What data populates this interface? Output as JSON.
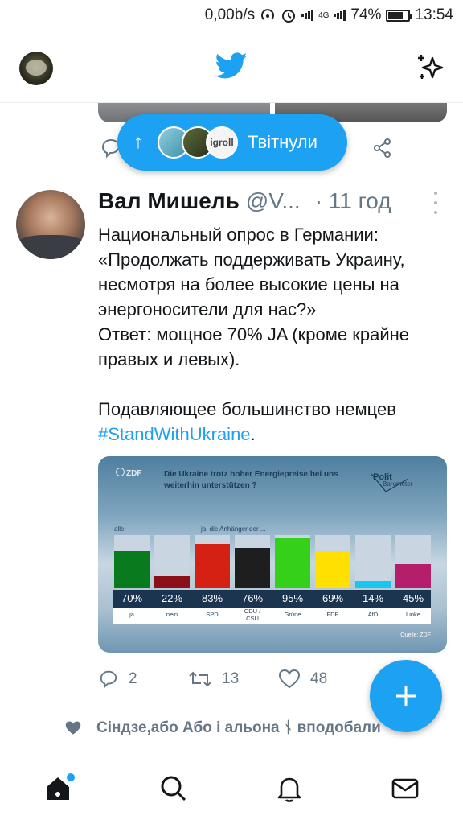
{
  "status_bar": {
    "speed": "0,00b/s",
    "network": "4G",
    "battery": "74%",
    "battery_level": 0.74,
    "time": "13:54"
  },
  "header": {
    "logo_icon": "twitter-bird-icon",
    "right_icon": "sparkle-icon",
    "brand_color": "#1da1f2"
  },
  "new_tweets_pill": {
    "label": "Твітнули",
    "avatar3_text": "igroll"
  },
  "tweet": {
    "name": "Вал Мишель",
    "handle": "@V...",
    "time": "· 11 год",
    "lines": [
      "Национальный опрос в Германии:",
      "«Продолжать поддерживать Украину, несмотря на более высокие цены на энергоносители для нас?»",
      "Ответ: мощное 70% JA (кроме крайне правых и левых)."
    ],
    "line2": "Подавляющее большинство немцев",
    "hashtag": "#StandWithUkraine",
    "trailing": ".",
    "actions": {
      "replies": "2",
      "retweets": "13",
      "likes": "48"
    },
    "liked_by": "Сіндзе,або Або і альона ᚾ вподобали"
  },
  "chart_data": {
    "type": "bar",
    "title": "Die Ukraine trotz hoher Energiepreise bei uns weiterhin unterstützen ?",
    "brand_left": "ZDF",
    "brand_right_top": "Polit",
    "brand_right_bottom": "Barometer",
    "group1_label": "alle",
    "group2_label": "ja, die Anhänger der ...",
    "source": "Quelle: ZDF",
    "ylim": [
      0,
      100
    ],
    "categories": [
      "ja",
      "nein",
      "SPD",
      "CDU / CSU",
      "Grüne",
      "FDP",
      "AfD",
      "Linke"
    ],
    "values": [
      70,
      22,
      83,
      76,
      95,
      69,
      14,
      45
    ],
    "value_labels": [
      "70%",
      "22%",
      "83%",
      "76%",
      "95%",
      "69%",
      "14%",
      "45%"
    ],
    "colors": [
      "#0a7a1e",
      "#8b1018",
      "#d42114",
      "#1e1e1e",
      "#35d11a",
      "#ffe000",
      "#17c7f0",
      "#b41e6a"
    ]
  },
  "bottom_nav": [
    "home-icon",
    "search-icon",
    "notifications-icon",
    "messages-icon"
  ]
}
